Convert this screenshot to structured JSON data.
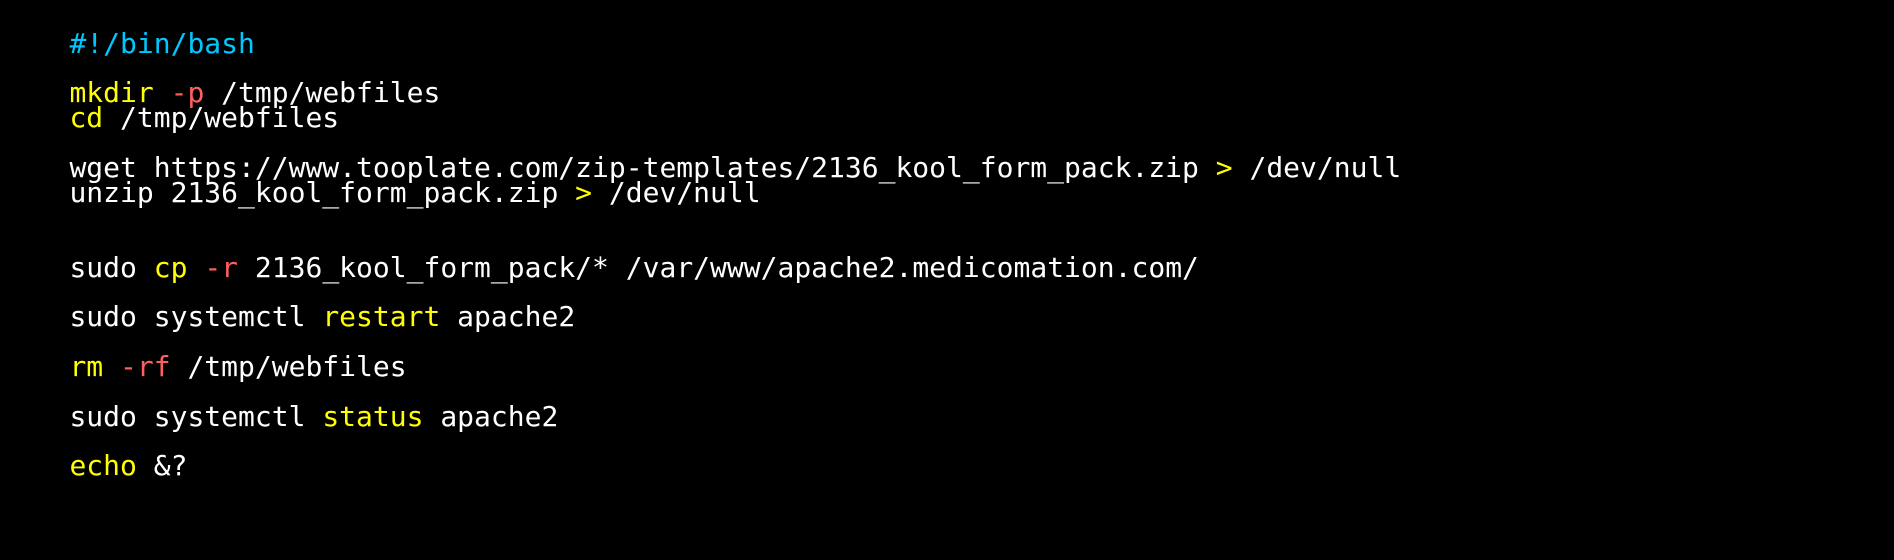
{
  "colors": {
    "background": "#000000",
    "plain": "#ffffff",
    "shebang": "#00c8ff",
    "keyword": "#ffff00",
    "flag": "#ff5f5f",
    "operator": "#ffff00"
  },
  "lines": [
    {
      "tokens": [
        {
          "text": "#!/bin/bash",
          "kind": "shebang"
        }
      ]
    },
    {
      "tokens": [
        {
          "text": "mkdir",
          "kind": "keyword"
        },
        {
          "text": " ",
          "kind": "plain"
        },
        {
          "text": "-p",
          "kind": "flag"
        },
        {
          "text": " /tmp/webfiles",
          "kind": "plain"
        }
      ]
    },
    {
      "tokens": [
        {
          "text": "cd",
          "kind": "keyword"
        },
        {
          "text": " /tmp/webfiles",
          "kind": "plain"
        }
      ]
    },
    {
      "tokens": [
        {
          "text": "wget https://www.tooplate.com/zip-templates/2136_kool_form_pack.zip ",
          "kind": "plain"
        },
        {
          "text": ">",
          "kind": "operator"
        },
        {
          "text": " /dev/null",
          "kind": "plain"
        }
      ]
    },
    {
      "tokens": [
        {
          "text": "unzip 2136_kool_form_pack.zip ",
          "kind": "plain"
        },
        {
          "text": ">",
          "kind": "operator"
        },
        {
          "text": " /dev/null",
          "kind": "plain"
        }
      ]
    },
    {
      "tokens": [
        {
          "text": "sudo ",
          "kind": "plain"
        },
        {
          "text": "cp",
          "kind": "keyword"
        },
        {
          "text": " ",
          "kind": "plain"
        },
        {
          "text": "-r",
          "kind": "flag"
        },
        {
          "text": " 2136_kool_form_pack/* /var/www/apache2.medicomation.com/",
          "kind": "plain"
        }
      ]
    },
    {
      "tokens": [
        {
          "text": "sudo systemctl ",
          "kind": "plain"
        },
        {
          "text": "restart",
          "kind": "keyword"
        },
        {
          "text": " apache2",
          "kind": "plain"
        }
      ]
    },
    {
      "tokens": [
        {
          "text": "rm",
          "kind": "keyword"
        },
        {
          "text": " ",
          "kind": "plain"
        },
        {
          "text": "-rf",
          "kind": "flag"
        },
        {
          "text": " /tmp/webfiles",
          "kind": "plain"
        }
      ]
    },
    {
      "tokens": [
        {
          "text": "sudo systemctl ",
          "kind": "plain"
        },
        {
          "text": "status",
          "kind": "keyword"
        },
        {
          "text": " apache2",
          "kind": "plain"
        }
      ]
    },
    {
      "tokens": [
        {
          "text": "echo",
          "kind": "keyword"
        },
        {
          "text": " &?",
          "kind": "plain"
        }
      ]
    }
  ]
}
